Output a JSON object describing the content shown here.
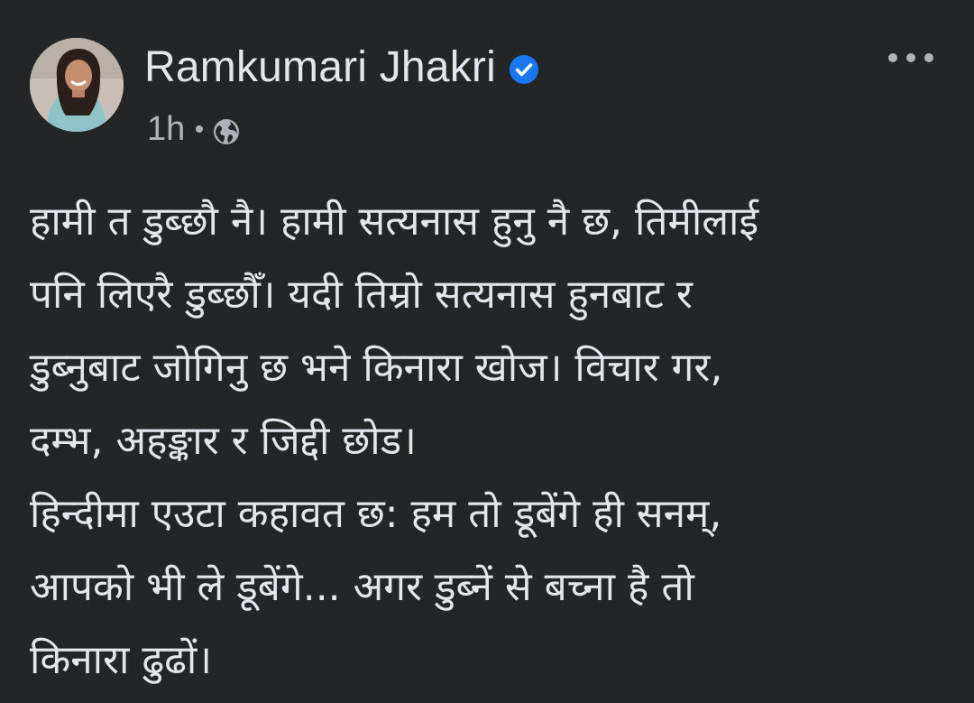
{
  "post": {
    "author_name": "Ramkumari Jhakri",
    "verified_icon": "verified-badge-icon",
    "timestamp": "1h",
    "privacy_icon": "globe-icon",
    "more_icon": "more-options-icon",
    "paragraph_1": "हामी त डुब्छौ नै। हामी सत्यनास हुनु नै छ, तिमीलाई\nपनि लिएरै डुब्छौँ। यदी तिम्रो सत्यनास हुनबाट र\nडुब्नुबाट जोगिनु छ भने किनारा खोज। विचार गर,\nदम्भ, अहङ्कार र जिद्दी छोड।",
    "paragraph_2": "हिन्दीमा एउटा कहावत छ: हम तो डूबेंगे ही सनम्,\nआपको भी ले डूबेंगे... अगर डुब्नें से बच्ना है तो\nकिनारा ढुढों।"
  },
  "colors": {
    "background": "#242526",
    "primary_text": "#e4e6eb",
    "secondary_text": "#b0b3b8",
    "verified_blue": "#1877f2"
  }
}
